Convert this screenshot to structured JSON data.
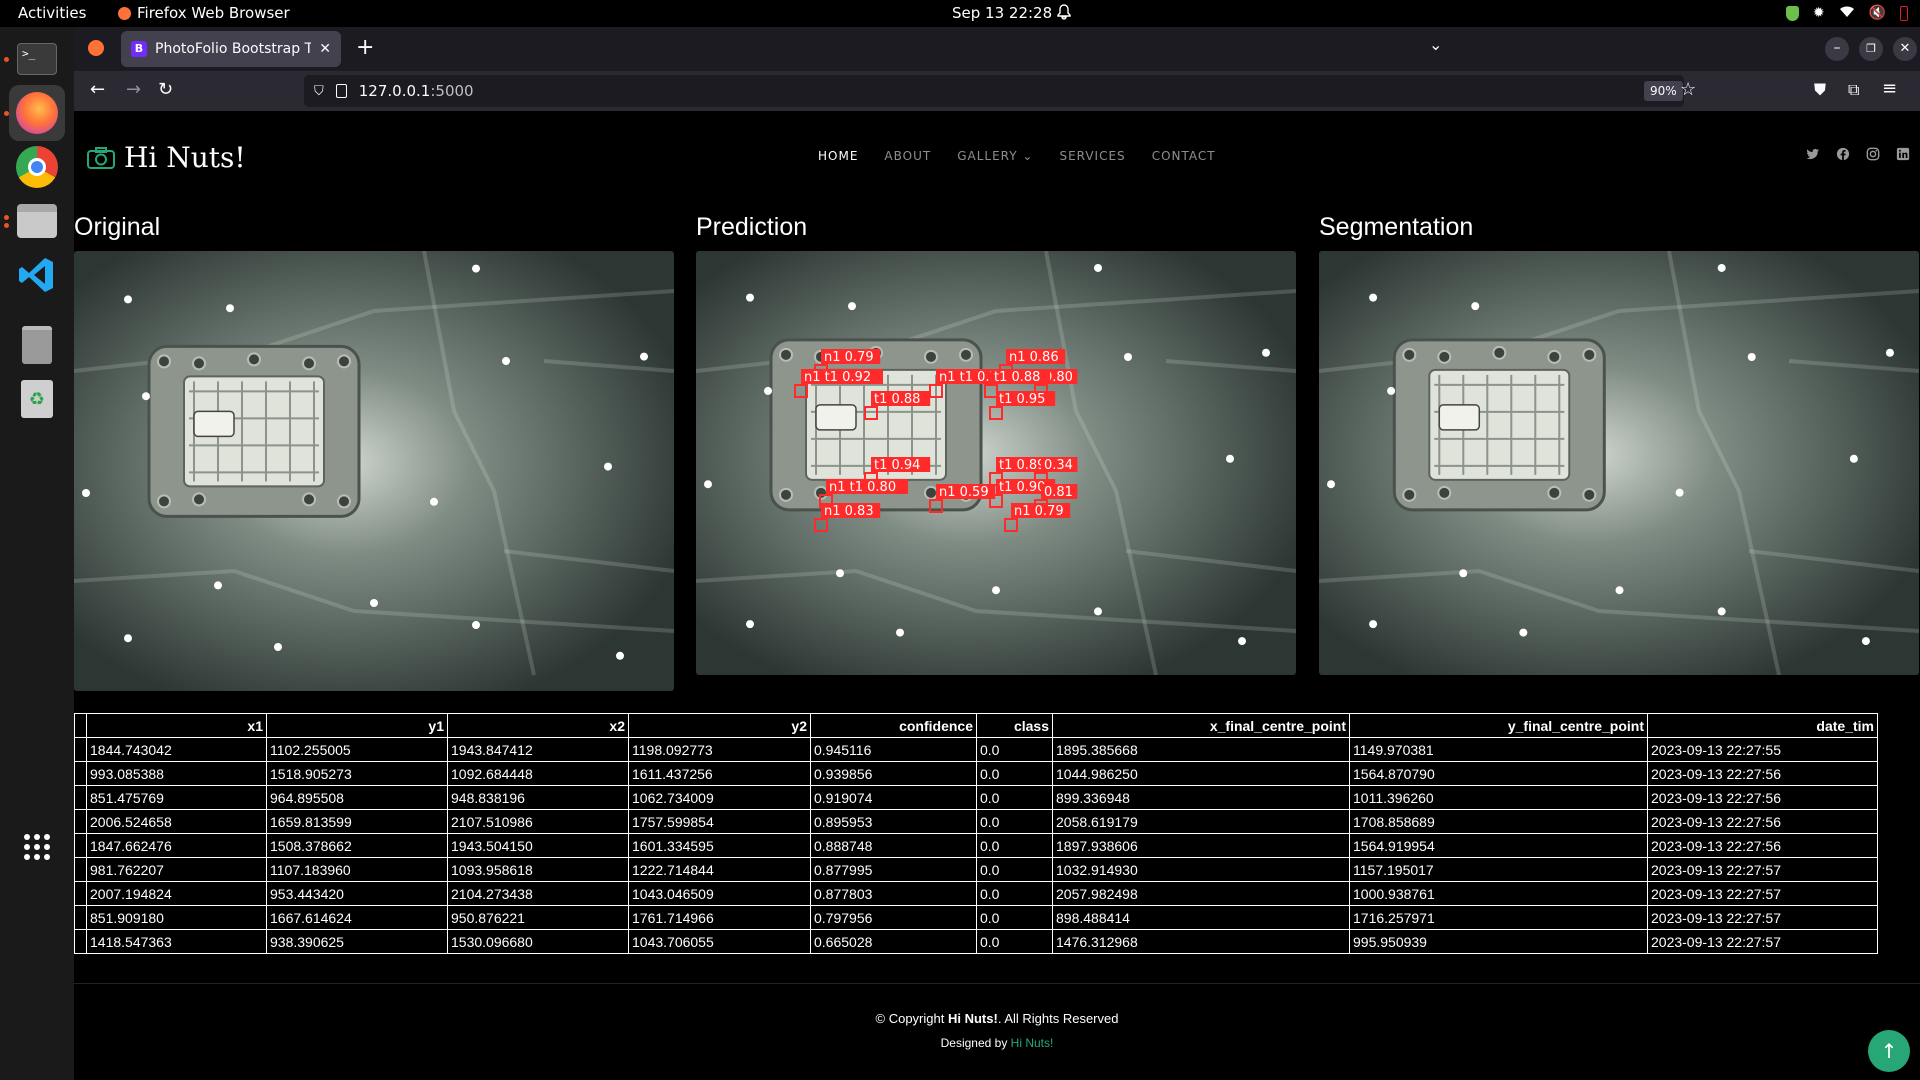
{
  "system": {
    "activities": "Activities",
    "app_name": "Firefox Web Browser",
    "clock": "Sep 13  22:28"
  },
  "browser": {
    "tab_title": "PhotoFolio Bootstrap Te",
    "tab_favicon": "B",
    "url_host": "127.0.0.1",
    "url_rest": ":5000",
    "zoom": "90%"
  },
  "site": {
    "brand": "Hi Nuts!",
    "menu": {
      "home": "HOME",
      "about": "ABOUT",
      "gallery": "GALLERY",
      "services": "SERVICES",
      "contact": "CONTACT"
    },
    "panels": {
      "original": "Original",
      "prediction": "Prediction",
      "segmentation": "Segmentation"
    },
    "detections": [
      {
        "label": "n1 0.79"
      },
      {
        "label": "n1 0.86"
      },
      {
        "label": "n1 t1 0.92"
      },
      {
        "label": "n1 t1 0.72"
      },
      {
        "label": "t1 0.88"
      },
      {
        "label": "0.80"
      },
      {
        "label": "t1 0.88"
      },
      {
        "label": "t1 0.95"
      },
      {
        "label": "t1 0.94"
      },
      {
        "label": "t1 0.89"
      },
      {
        "label": "0.34"
      },
      {
        "label": "n1 t1 0.80"
      },
      {
        "label": "n1 0.59"
      },
      {
        "label": "t1 0.90"
      },
      {
        "label": "0.81"
      },
      {
        "label": "n1 0.83"
      },
      {
        "label": "n1 0.79"
      }
    ],
    "table": {
      "headers": [
        "x1",
        "y1",
        "x2",
        "y2",
        "confidence",
        "class",
        "x_final_centre_point",
        "y_final_centre_point",
        "date_tim"
      ],
      "rows": [
        [
          "1844.743042",
          "1102.255005",
          "1943.847412",
          "1198.092773",
          "0.945116",
          "0.0",
          "1895.385668",
          "1149.970381",
          "2023-09-13 22:27:55"
        ],
        [
          "993.085388",
          "1518.905273",
          "1092.684448",
          "1611.437256",
          "0.939856",
          "0.0",
          "1044.986250",
          "1564.870790",
          "2023-09-13 22:27:56"
        ],
        [
          "851.475769",
          "964.895508",
          "948.838196",
          "1062.734009",
          "0.919074",
          "0.0",
          "899.336948",
          "1011.396260",
          "2023-09-13 22:27:56"
        ],
        [
          "2006.524658",
          "1659.813599",
          "2107.510986",
          "1757.599854",
          "0.895953",
          "0.0",
          "2058.619179",
          "1708.858689",
          "2023-09-13 22:27:56"
        ],
        [
          "1847.662476",
          "1508.378662",
          "1943.504150",
          "1601.334595",
          "0.888748",
          "0.0",
          "1897.938606",
          "1564.919954",
          "2023-09-13 22:27:56"
        ],
        [
          "981.762207",
          "1107.183960",
          "1093.958618",
          "1222.714844",
          "0.877995",
          "0.0",
          "1032.914930",
          "1157.195017",
          "2023-09-13 22:27:57"
        ],
        [
          "2007.194824",
          "953.443420",
          "2104.273438",
          "1043.046509",
          "0.877803",
          "0.0",
          "2057.982498",
          "1000.938761",
          "2023-09-13 22:27:57"
        ],
        [
          "851.909180",
          "1667.614624",
          "950.876221",
          "1761.714966",
          "0.797956",
          "0.0",
          "898.488414",
          "1716.257971",
          "2023-09-13 22:27:57"
        ],
        [
          "1418.547363",
          "938.390625",
          "1530.096680",
          "1043.706055",
          "0.665028",
          "0.0",
          "1476.312968",
          "995.950939",
          "2023-09-13 22:27:57"
        ]
      ]
    },
    "footer": {
      "copyright_prefix": "© Copyright ",
      "copyright_brand": "Hi Nuts!",
      "copyright_suffix": ". All Rights Reserved",
      "designed_prefix": "Designed by ",
      "designed_brand": "Hi Nuts!"
    }
  },
  "colors": {
    "accent": "#27a776",
    "detection_box": "#ff2b2b"
  }
}
